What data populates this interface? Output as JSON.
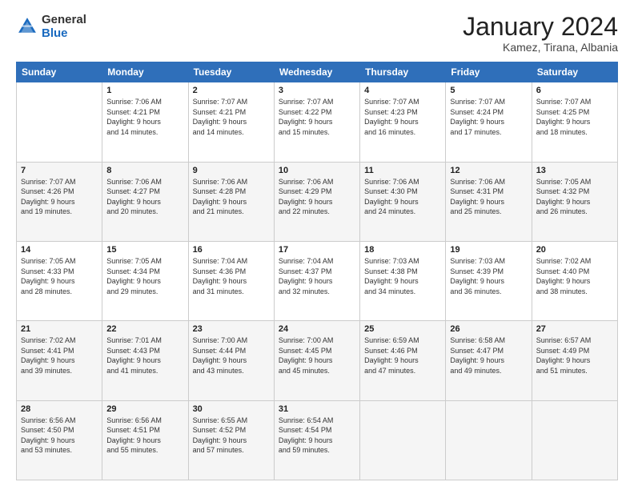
{
  "header": {
    "logo_general": "General",
    "logo_blue": "Blue",
    "title": "January 2024",
    "subtitle": "Kamez, Tirana, Albania"
  },
  "weekdays": [
    "Sunday",
    "Monday",
    "Tuesday",
    "Wednesday",
    "Thursday",
    "Friday",
    "Saturday"
  ],
  "rows": [
    [
      {
        "date": "",
        "info": ""
      },
      {
        "date": "1",
        "info": "Sunrise: 7:06 AM\nSunset: 4:21 PM\nDaylight: 9 hours\nand 14 minutes."
      },
      {
        "date": "2",
        "info": "Sunrise: 7:07 AM\nSunset: 4:21 PM\nDaylight: 9 hours\nand 14 minutes."
      },
      {
        "date": "3",
        "info": "Sunrise: 7:07 AM\nSunset: 4:22 PM\nDaylight: 9 hours\nand 15 minutes."
      },
      {
        "date": "4",
        "info": "Sunrise: 7:07 AM\nSunset: 4:23 PM\nDaylight: 9 hours\nand 16 minutes."
      },
      {
        "date": "5",
        "info": "Sunrise: 7:07 AM\nSunset: 4:24 PM\nDaylight: 9 hours\nand 17 minutes."
      },
      {
        "date": "6",
        "info": "Sunrise: 7:07 AM\nSunset: 4:25 PM\nDaylight: 9 hours\nand 18 minutes."
      }
    ],
    [
      {
        "date": "7",
        "info": "Sunrise: 7:07 AM\nSunset: 4:26 PM\nDaylight: 9 hours\nand 19 minutes."
      },
      {
        "date": "8",
        "info": "Sunrise: 7:06 AM\nSunset: 4:27 PM\nDaylight: 9 hours\nand 20 minutes."
      },
      {
        "date": "9",
        "info": "Sunrise: 7:06 AM\nSunset: 4:28 PM\nDaylight: 9 hours\nand 21 minutes."
      },
      {
        "date": "10",
        "info": "Sunrise: 7:06 AM\nSunset: 4:29 PM\nDaylight: 9 hours\nand 22 minutes."
      },
      {
        "date": "11",
        "info": "Sunrise: 7:06 AM\nSunset: 4:30 PM\nDaylight: 9 hours\nand 24 minutes."
      },
      {
        "date": "12",
        "info": "Sunrise: 7:06 AM\nSunset: 4:31 PM\nDaylight: 9 hours\nand 25 minutes."
      },
      {
        "date": "13",
        "info": "Sunrise: 7:05 AM\nSunset: 4:32 PM\nDaylight: 9 hours\nand 26 minutes."
      }
    ],
    [
      {
        "date": "14",
        "info": "Sunrise: 7:05 AM\nSunset: 4:33 PM\nDaylight: 9 hours\nand 28 minutes."
      },
      {
        "date": "15",
        "info": "Sunrise: 7:05 AM\nSunset: 4:34 PM\nDaylight: 9 hours\nand 29 minutes."
      },
      {
        "date": "16",
        "info": "Sunrise: 7:04 AM\nSunset: 4:36 PM\nDaylight: 9 hours\nand 31 minutes."
      },
      {
        "date": "17",
        "info": "Sunrise: 7:04 AM\nSunset: 4:37 PM\nDaylight: 9 hours\nand 32 minutes."
      },
      {
        "date": "18",
        "info": "Sunrise: 7:03 AM\nSunset: 4:38 PM\nDaylight: 9 hours\nand 34 minutes."
      },
      {
        "date": "19",
        "info": "Sunrise: 7:03 AM\nSunset: 4:39 PM\nDaylight: 9 hours\nand 36 minutes."
      },
      {
        "date": "20",
        "info": "Sunrise: 7:02 AM\nSunset: 4:40 PM\nDaylight: 9 hours\nand 38 minutes."
      }
    ],
    [
      {
        "date": "21",
        "info": "Sunrise: 7:02 AM\nSunset: 4:41 PM\nDaylight: 9 hours\nand 39 minutes."
      },
      {
        "date": "22",
        "info": "Sunrise: 7:01 AM\nSunset: 4:43 PM\nDaylight: 9 hours\nand 41 minutes."
      },
      {
        "date": "23",
        "info": "Sunrise: 7:00 AM\nSunset: 4:44 PM\nDaylight: 9 hours\nand 43 minutes."
      },
      {
        "date": "24",
        "info": "Sunrise: 7:00 AM\nSunset: 4:45 PM\nDaylight: 9 hours\nand 45 minutes."
      },
      {
        "date": "25",
        "info": "Sunrise: 6:59 AM\nSunset: 4:46 PM\nDaylight: 9 hours\nand 47 minutes."
      },
      {
        "date": "26",
        "info": "Sunrise: 6:58 AM\nSunset: 4:47 PM\nDaylight: 9 hours\nand 49 minutes."
      },
      {
        "date": "27",
        "info": "Sunrise: 6:57 AM\nSunset: 4:49 PM\nDaylight: 9 hours\nand 51 minutes."
      }
    ],
    [
      {
        "date": "28",
        "info": "Sunrise: 6:56 AM\nSunset: 4:50 PM\nDaylight: 9 hours\nand 53 minutes."
      },
      {
        "date": "29",
        "info": "Sunrise: 6:56 AM\nSunset: 4:51 PM\nDaylight: 9 hours\nand 55 minutes."
      },
      {
        "date": "30",
        "info": "Sunrise: 6:55 AM\nSunset: 4:52 PM\nDaylight: 9 hours\nand 57 minutes."
      },
      {
        "date": "31",
        "info": "Sunrise: 6:54 AM\nSunset: 4:54 PM\nDaylight: 9 hours\nand 59 minutes."
      },
      {
        "date": "",
        "info": ""
      },
      {
        "date": "",
        "info": ""
      },
      {
        "date": "",
        "info": ""
      }
    ]
  ]
}
